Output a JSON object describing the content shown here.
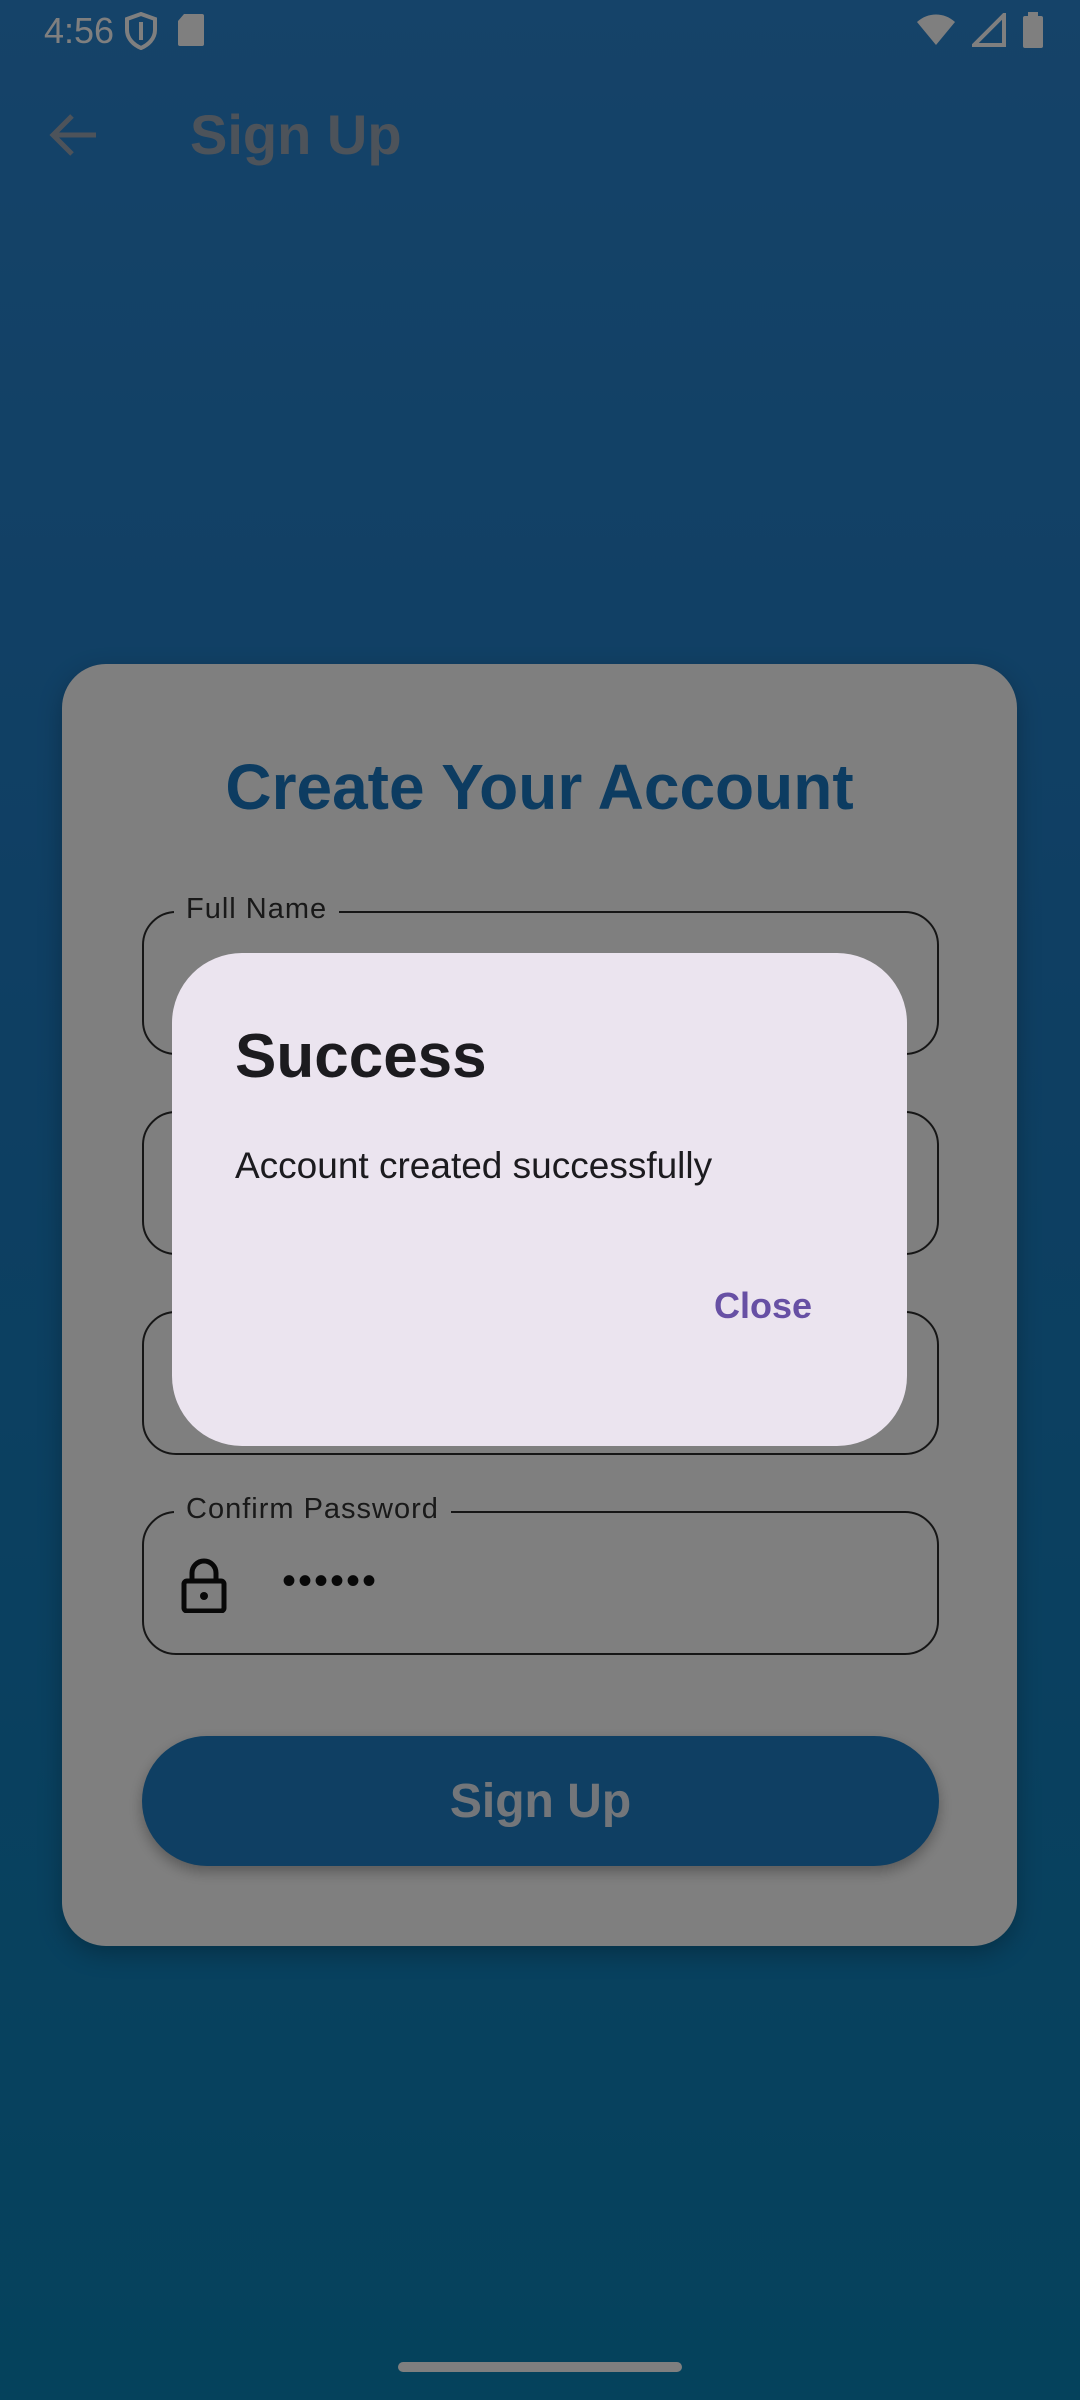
{
  "status_bar": {
    "time": "4:56",
    "icons_left": [
      "shield-icon",
      "sd-card-icon"
    ],
    "icons_right": [
      "wifi-icon",
      "cell-signal-icon",
      "battery-icon"
    ]
  },
  "app_bar": {
    "back_icon": "arrow-back-icon",
    "title": "Sign Up"
  },
  "form": {
    "title": "Create Your Account",
    "fields": [
      {
        "label": "Full Name",
        "value": ""
      },
      {
        "label": "",
        "value": ""
      },
      {
        "label": "",
        "value": ""
      },
      {
        "label": "Confirm Password",
        "value": "••••••",
        "icon": "lock-icon"
      }
    ],
    "submit_label": "Sign Up"
  },
  "dialog": {
    "title": "Success",
    "message": "Account created successfully",
    "close_label": "Close"
  },
  "colors": {
    "accent": "#1e7ec6",
    "dialog_bg": "#ebe4ef",
    "dialog_action": "#6750a4"
  }
}
